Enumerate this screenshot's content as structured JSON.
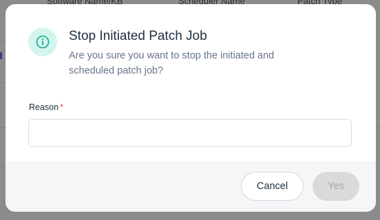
{
  "background": {
    "columns": [
      "Software Name/KB",
      "Scheduler Name",
      "Patch Type"
    ]
  },
  "dialog": {
    "icon": "info-icon",
    "title": "Stop Initiated Patch Job",
    "message": "Are you sure you want to stop the initiated and scheduled patch job?",
    "reason_label": "Reason",
    "required_marker": "*",
    "reason_value": "",
    "cancel_label": "Cancel",
    "confirm_label": "Yes"
  },
  "colors": {
    "accent": "#1aa58a",
    "icon_bg": "#d3f5ee",
    "overlay": "#8c8c8c",
    "required": "#e5484d",
    "disabled_button": "#dadada"
  }
}
